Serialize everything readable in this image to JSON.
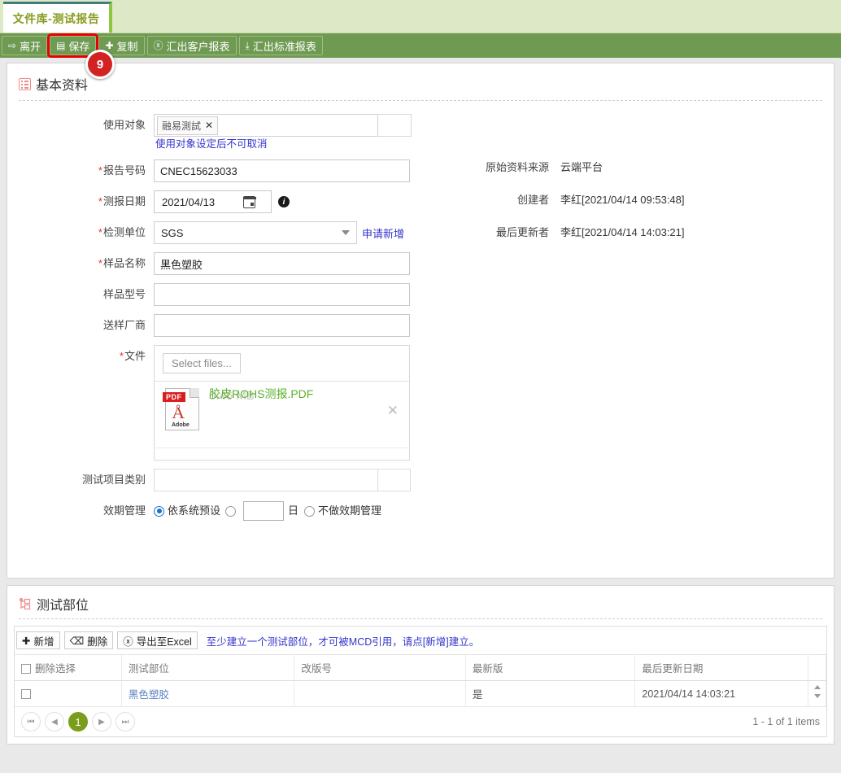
{
  "tab": {
    "label": "文件库-测试报告"
  },
  "toolbar": {
    "buttons": [
      {
        "label": "离开",
        "icon": "exit-icon",
        "glyph": "⇥"
      },
      {
        "label": "保存",
        "icon": "save-icon",
        "glyph": "▤",
        "highlighted": true
      },
      {
        "label": "复制",
        "icon": "plus-icon",
        "glyph": "✚"
      },
      {
        "label": "汇出客户报表",
        "icon": "excel-icon",
        "glyph": "x"
      },
      {
        "label": "汇出标准报表",
        "icon": "download-icon",
        "glyph": "⬓"
      }
    ],
    "step_badge": "9"
  },
  "basic_section": {
    "title": "基本资料",
    "icon": "list-icon",
    "fields": {
      "audience_label": "使用对象",
      "audience_token": "融易測試",
      "audience_hint": "使用对象设定后不可取消",
      "report_no_label": "报告号码",
      "report_no_value": "CNEC15623033",
      "report_date_label": "测报日期",
      "report_date_value": "2021/04/13",
      "lab_label": "检测单位",
      "lab_value": "SGS",
      "lab_apply_link": "申请新增",
      "sample_name_label": "样品名称",
      "sample_name_value": "黑色塑胶",
      "sample_model_label": "样品型号",
      "sample_model_value": "",
      "supplier_label": "送样厂商",
      "supplier_value": "",
      "file_label": "文件",
      "file_select_button": "Select files...",
      "file_name": "胶皮ROHS测报.PDF",
      "file_size": "0.46 MB",
      "category_label": "测试项目类别",
      "category_value": "",
      "validity_label": "效期管理",
      "validity_option_system": "依系统预设",
      "validity_unit": "日",
      "validity_option_none": "不做效期管理"
    },
    "meta": [
      {
        "label": "原始资料来源",
        "value": "云端平台"
      },
      {
        "label": "创建者",
        "value": "李红[2021/04/14 09:53:48]"
      },
      {
        "label": "最后更新者",
        "value": "李红[2021/04/14 14:03:21]"
      }
    ]
  },
  "parts_section": {
    "title": "测试部位",
    "icon": "tree-icon",
    "tools": [
      {
        "label": "新增",
        "icon": "plus-icon",
        "glyph": "✚"
      },
      {
        "label": "删除",
        "icon": "trash-icon",
        "glyph": "🗑"
      },
      {
        "label": "导出至Excel",
        "icon": "excel-icon",
        "glyph": "x"
      }
    ],
    "note": "至少建立一个测试部位，才可被MCD引用，请点[新增]建立。",
    "columns": [
      "删除选择",
      "测试部位",
      "改版号",
      "最新版",
      "最后更新日期"
    ],
    "rows": [
      {
        "select": "",
        "part": "黑色塑胶",
        "revision": "",
        "latest": "是",
        "updated": "2021/04/14 14:03:21"
      }
    ],
    "pager": {
      "first": "⏮",
      "prev": "◀",
      "current": "1",
      "next": "▶",
      "last": "⏭",
      "items_text": "1 - 1 of 1 items"
    }
  }
}
